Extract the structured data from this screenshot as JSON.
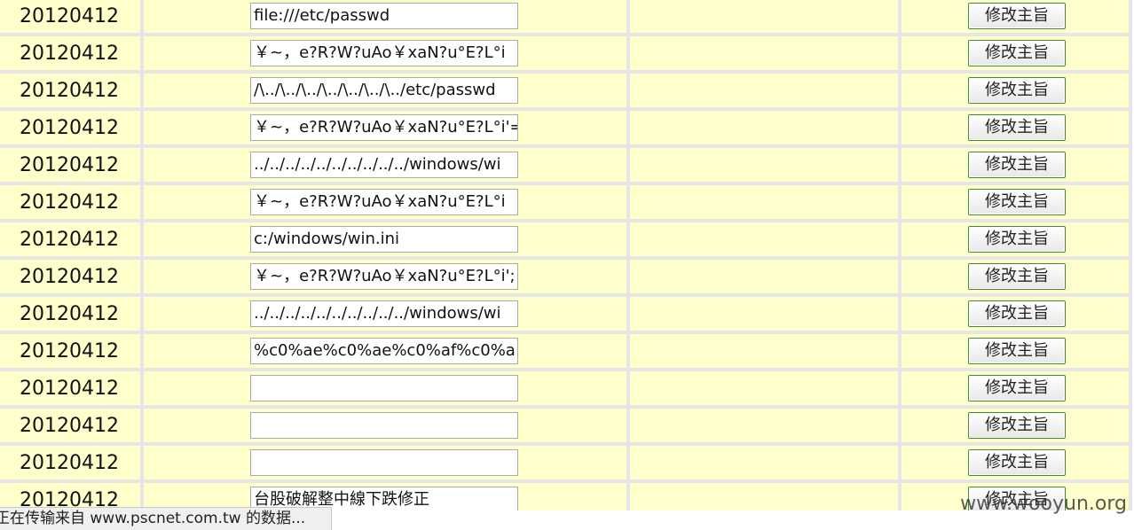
{
  "rows": [
    {
      "date": "20120412",
      "value": "file:///etc/passwd",
      "button": "修改主旨"
    },
    {
      "date": "20120412",
      "value": "￥~，e?R?W?uAo￥xaN?u°E?L°i",
      "button": "修改主旨"
    },
    {
      "date": "20120412",
      "value": "/\\../\\../\\../\\../\\../\\../\\../etc/passwd",
      "button": "修改主旨"
    },
    {
      "date": "20120412",
      "value": "￥~，e?R?W?uAo￥xaN?u°E?L°i'=",
      "button": "修改主旨"
    },
    {
      "date": "20120412",
      "value": "../../../../../../../../../../windows/wi",
      "button": "修改主旨"
    },
    {
      "date": "20120412",
      "value": "￥~，e?R?W?uAo￥xaN?u°E?L°i",
      "button": "修改主旨"
    },
    {
      "date": "20120412",
      "value": "c:/windows/win.ini",
      "button": "修改主旨"
    },
    {
      "date": "20120412",
      "value": "￥~，e?R?W?uAo￥xaN?u°E?L°i';",
      "button": "修改主旨"
    },
    {
      "date": "20120412",
      "value": "../../../../../../../../../../windows/wi",
      "button": "修改主旨"
    },
    {
      "date": "20120412",
      "value": "%c0%ae%c0%ae%c0%af%c0%a",
      "button": "修改主旨"
    },
    {
      "date": "20120412",
      "value": "",
      "button": "修改主旨"
    },
    {
      "date": "20120412",
      "value": "",
      "button": "修改主旨"
    },
    {
      "date": "20120412",
      "value": "",
      "button": "修改主旨"
    },
    {
      "date": "20120412",
      "value": "台股破解整中線下跌修正",
      "button": "修改主旨"
    }
  ],
  "statusbar": {
    "text": "正在传输来自 www.pscnet.com.tw 的数据..."
  },
  "watermark": {
    "text": "www.wooyun.org"
  }
}
